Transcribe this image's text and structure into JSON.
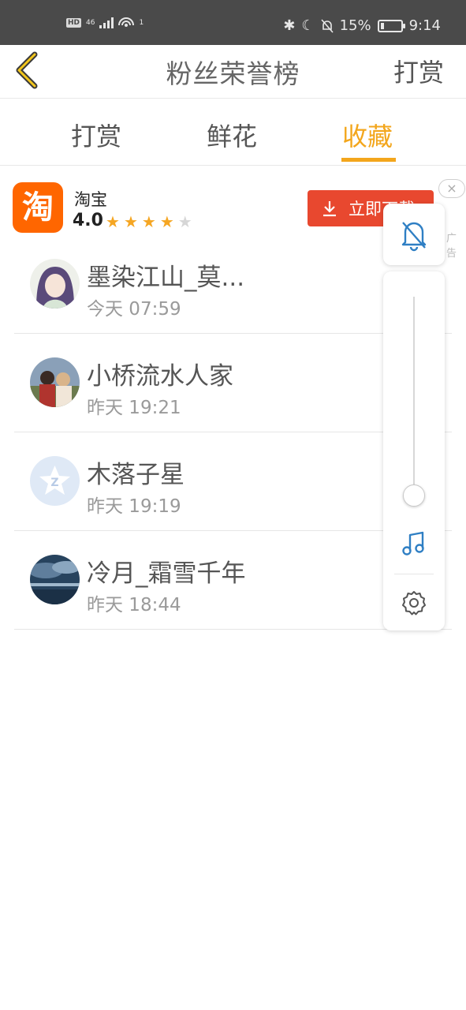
{
  "status_bar": {
    "left_badge": "HD",
    "network": "46",
    "hotspot_count": "1",
    "battery": "15%",
    "battery_level": 0.15,
    "time": "9:14"
  },
  "header": {
    "title": "粉丝荣誉榜",
    "action": "打赏"
  },
  "tabs": [
    {
      "label": "打赏",
      "active": false
    },
    {
      "label": "鲜花",
      "active": false
    },
    {
      "label": "收藏",
      "active": true
    }
  ],
  "ad": {
    "app_name": "淘宝",
    "logo_text": "淘",
    "rating": "4.0",
    "stars": 4,
    "button_label": "立即下载",
    "close": "×",
    "tag": "广告"
  },
  "list": [
    {
      "name": "墨染江山_莫...",
      "time": "今天 07:59",
      "avatar": "anime-girl"
    },
    {
      "name": "小桥流水人家",
      "time": "昨天 19:21",
      "avatar": "couple"
    },
    {
      "name": "木落子星",
      "time": "昨天 19:19",
      "avatar": "qq-default"
    },
    {
      "name": "冷月_霜雪千年",
      "time": "昨天 18:44",
      "avatar": "cloud-scene"
    }
  ],
  "floating_panel": {
    "volume_level": 0.04,
    "icons": [
      "bell-muted-icon",
      "music-icon",
      "gear-icon"
    ]
  },
  "colors": {
    "accent": "#f3a61c",
    "ad_button": "#e8482f",
    "panel_blue": "#2f7fc4"
  }
}
